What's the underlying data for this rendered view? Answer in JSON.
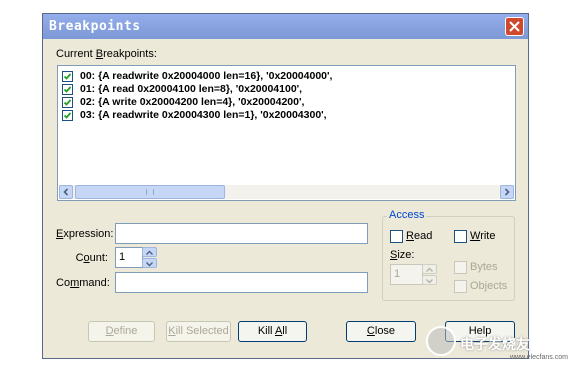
{
  "dialog": {
    "title": "Breakpoints",
    "current_label_pre": "Current ",
    "current_label_u": "B",
    "current_label_post": "reakpoints:"
  },
  "breakpoints": [
    {
      "checked": true,
      "text": "00: {A readwrite 0x20004000 len=16},  '0x20004000',"
    },
    {
      "checked": true,
      "text": "01: {A read 0x20004100 len=8},  '0x20004100',"
    },
    {
      "checked": true,
      "text": "02: {A write 0x20004200 len=4},  '0x20004200',"
    },
    {
      "checked": true,
      "text": "03: {A readwrite 0x20004300 len=1},  '0x20004300',"
    }
  ],
  "fields": {
    "expression_u": "E",
    "expression_rest": "xpression:",
    "expression_value": "",
    "count_pre": "C",
    "count_u": "o",
    "count_post": "unt:",
    "count_value": "1",
    "command_pre": "Co",
    "command_u": "m",
    "command_post": "mand:",
    "command_value": ""
  },
  "access": {
    "title": "Access",
    "read_u": "R",
    "read_rest": "ead",
    "read_checked": false,
    "write_u": "W",
    "write_rest": "rite",
    "write_checked": false,
    "size_u": "S",
    "size_rest": "ize:",
    "size_value": "1",
    "bytes_label": "Bytes",
    "bytes_enabled": false,
    "objects_label": "Objects",
    "objects_enabled": false
  },
  "buttons": {
    "define_u": "D",
    "define_rest": "efine",
    "kill_selected_u": "K",
    "kill_selected_rest": "ill Selected",
    "kill_all_pre": "Kill ",
    "kill_all_u": "A",
    "kill_all_post": "ll",
    "close_u": "C",
    "close_rest": "lose",
    "help": "Help"
  },
  "watermark": {
    "text": "电子发烧友",
    "sub": "www.elecfans.com"
  },
  "colors": {
    "title_bar": "#8ca6e3",
    "dialog_bg": "#ece9d8",
    "close_button": "#d0492f",
    "group_title": "#0046d5"
  }
}
